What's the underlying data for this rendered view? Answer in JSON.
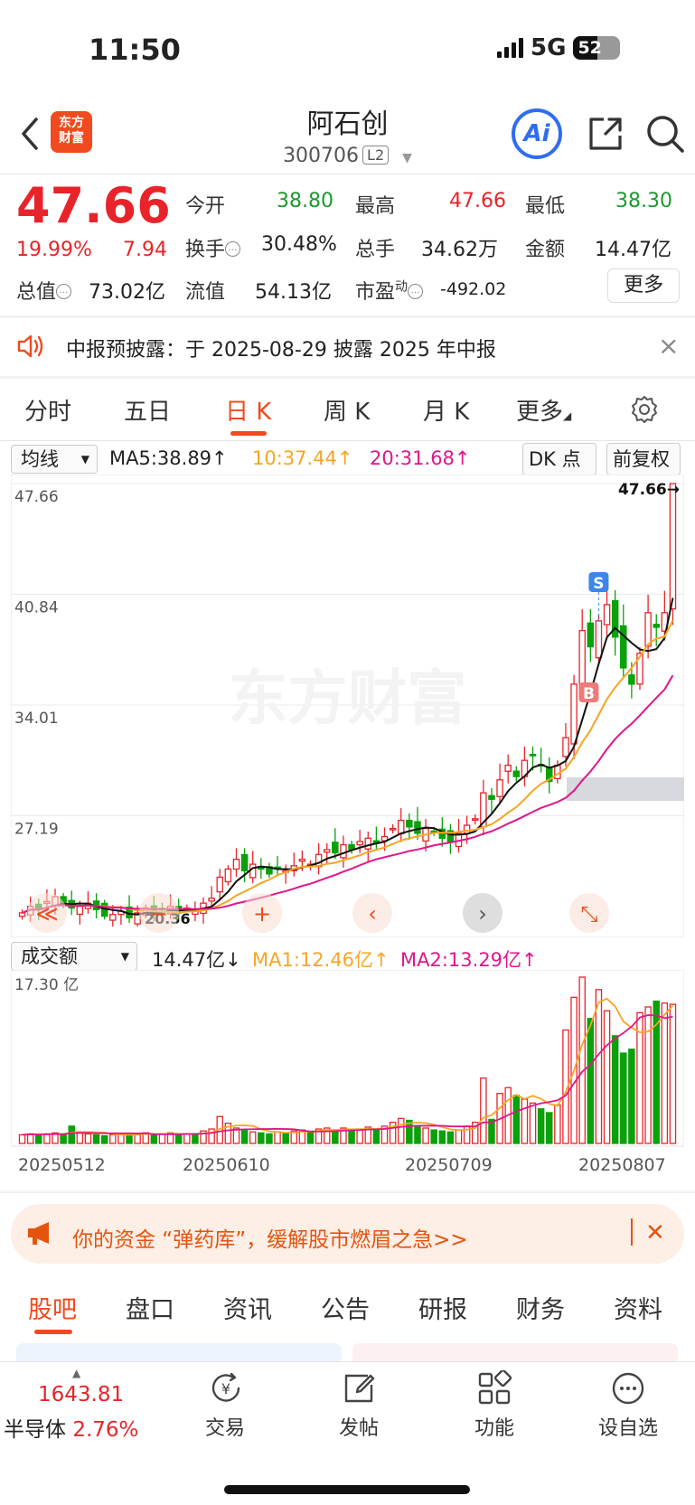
{
  "status_bar": {
    "time": "11:50",
    "network": "5G",
    "battery": "52"
  },
  "header": {
    "logo_line1": "东方",
    "logo_line2": "财富",
    "stock_name": "阿石创",
    "stock_code": "300706",
    "level_badge": "L2",
    "ai_label": "Ai"
  },
  "quote": {
    "price": "47.66",
    "change_pct": "19.99%",
    "change_amt": "7.94",
    "fields": {
      "open_label": "今开",
      "open_value": "38.80",
      "high_label": "最高",
      "high_value": "47.66",
      "low_label": "最低",
      "low_value": "38.30",
      "turnover_label": "换手",
      "turnover_value": "30.48%",
      "volume_label": "总手",
      "volume_value": "34.62万",
      "amount_label": "金额",
      "amount_value": "14.47亿",
      "mktcap_label": "总值",
      "mktcap_value": "73.02亿",
      "float_label": "流值",
      "float_value": "54.13亿",
      "pe_label": "市盈",
      "pe_sup": "动",
      "pe_value": "-492.02"
    },
    "more_label": "更多"
  },
  "notice": {
    "text": "中报预披露：于 2025-08-29 披露 2025 年中报"
  },
  "chart_tabs": [
    "分时",
    "五日",
    "日 K",
    "周 K",
    "月 K",
    "更多"
  ],
  "indicators": {
    "ma_select": "均线",
    "ma5": "MA5:38.89↑",
    "ma10": "10:37.44↑",
    "ma20": "20:31.68↑",
    "dk_label": "DK 点",
    "adjust_label": "前复权",
    "vol_select": "成交额",
    "vol_value": "14.47亿↓",
    "vol_ma1": "MA1:12.46亿↑",
    "vol_ma2": "MA2:13.29亿↑"
  },
  "chart_data": {
    "type": "candlestick",
    "y_ticks": [
      "47.66",
      "40.84",
      "34.01",
      "27.19"
    ],
    "low_label": "20.36",
    "last_price_label": "47.66→",
    "signal_buy": "B",
    "signal_sell": "S",
    "watermark": "东方财富",
    "ylim": [
      20.36,
      47.66
    ],
    "volume_max_label": "17.30 亿",
    "x_labels": [
      "20250512",
      "20250610",
      "20250709",
      "20250807"
    ],
    "colors": {
      "up": "#e8242a",
      "down": "#0aa10a",
      "ma5": "#111111",
      "ma10": "#f5a623",
      "ma20": "#e0168a"
    },
    "closes": [
      21.2,
      21.6,
      21.4,
      21.9,
      22.2,
      21.7,
      21.5,
      21.6,
      21.8,
      21.4,
      21.0,
      21.1,
      21.3,
      20.9,
      21.2,
      21.5,
      21.1,
      21.4,
      21.6,
      21.2,
      21.5,
      21.3,
      21.8,
      22.1,
      23.4,
      23.9,
      24.5,
      23.8,
      24.2,
      23.9,
      23.6,
      24.0,
      23.8,
      24.1,
      24.5,
      24.2,
      24.8,
      25.1,
      24.9,
      25.4,
      25.1,
      25.6,
      25.8,
      25.5,
      25.9,
      26.4,
      26.9,
      26.5,
      26.1,
      26.4,
      26.2,
      25.8,
      25.6,
      26.1,
      26.6,
      27.0,
      28.6,
      28.2,
      29.4,
      30.3,
      29.6,
      30.6,
      30.9,
      30.3,
      29.3,
      30.3,
      32.0,
      35.3,
      38.6,
      37.6,
      39.2,
      40.2,
      38.2,
      36.3,
      35.3,
      37.2,
      39.7,
      38.8,
      39.7,
      47.66
    ],
    "volumes": [
      0.9,
      1.0,
      0.9,
      1.0,
      1.1,
      0.9,
      1.8,
      1.2,
      1.0,
      0.9,
      0.8,
      0.9,
      1.0,
      0.9,
      1.0,
      1.1,
      0.9,
      1.0,
      1.1,
      0.9,
      1.0,
      1.0,
      1.3,
      1.5,
      2.8,
      2.1,
      1.6,
      1.4,
      1.2,
      1.1,
      1.0,
      1.2,
      1.1,
      1.3,
      1.4,
      1.2,
      1.5,
      1.6,
      1.4,
      1.6,
      1.3,
      1.5,
      1.7,
      1.5,
      1.8,
      2.2,
      2.6,
      2.4,
      1.8,
      1.6,
      1.4,
      1.3,
      1.2,
      1.4,
      1.8,
      2.2,
      6.8,
      2.5,
      5.2,
      5.8,
      5.0,
      4.6,
      4.2,
      3.6,
      3.2,
      4.0,
      11.8,
      15.2,
      17.3,
      13.0,
      16.0,
      13.8,
      11.2,
      9.4,
      9.8,
      13.6,
      14.2,
      14.8,
      14.6,
      14.47
    ]
  },
  "ad": {
    "text": "你的资金 “弹药库”，缓解股市燃眉之急>>"
  },
  "bottom_tabs": [
    "股吧",
    "盘口",
    "资讯",
    "公告",
    "研报",
    "财务",
    "资料"
  ],
  "toolbar": {
    "index_value": "1643.81",
    "sector_name": "半导体",
    "sector_pct": "2.76%",
    "trade_label": "交易",
    "post_label": "发帖",
    "func_label": "功能",
    "watch_label": "设自选"
  }
}
